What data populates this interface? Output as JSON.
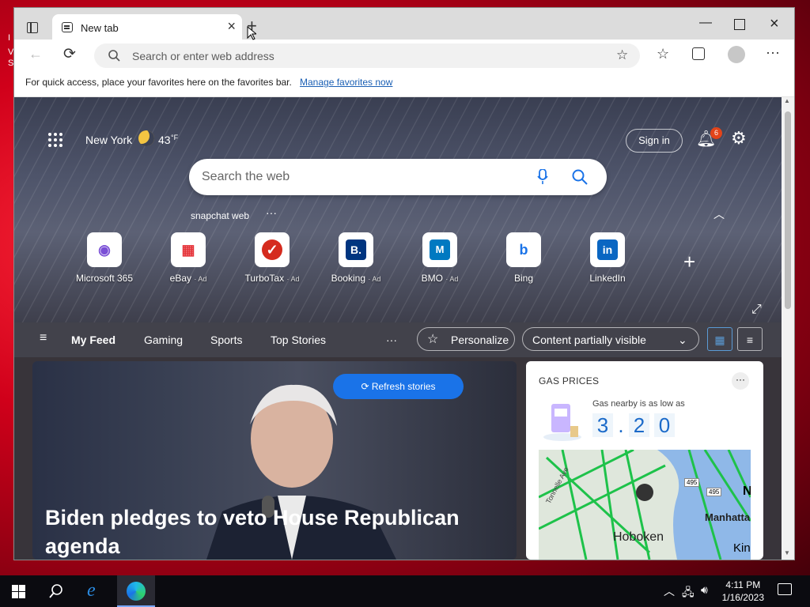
{
  "desktop": {
    "left_letters": [
      "I",
      "V",
      "S"
    ]
  },
  "browser": {
    "tab_title": "New tab",
    "address_placeholder": "Search or enter web address",
    "favorites_bar_text": "For quick access, place your favorites here on the favorites bar.",
    "favorites_bar_link": "Manage favorites now"
  },
  "newtab": {
    "location": "New York",
    "temperature": "43",
    "temp_unit": "°F",
    "search_placeholder": "Search the web",
    "suggestion": "snapchat web",
    "sign_in": "Sign in",
    "notification_count": "6",
    "quick_links": [
      {
        "label": "Microsoft 365",
        "ad": ""
      },
      {
        "label": "eBay",
        "ad": "· Ad"
      },
      {
        "label": "TurboTax",
        "ad": "· Ad"
      },
      {
        "label": "Booking",
        "ad": "· Ad"
      },
      {
        "label": "BMO",
        "ad": "· Ad"
      },
      {
        "label": "Bing",
        "ad": ""
      },
      {
        "label": "LinkedIn",
        "ad": ""
      }
    ],
    "feed_tabs": [
      "My Feed",
      "Gaming",
      "Sports",
      "Top Stories"
    ],
    "more": "···",
    "personalize": "Personalize",
    "content_visibility": "Content partially visible",
    "refresh": "Refresh stories",
    "headline": "Biden pledges to veto House Republican agenda",
    "gas": {
      "title": "GAS PRICES",
      "subtitle": "Gas nearby is as low as",
      "digits": [
        "3",
        "2",
        "0"
      ],
      "separator": ".",
      "map_labels": [
        "Hoboken",
        "Manhatta",
        "495",
        "495",
        "Tonnelle Ave",
        "N",
        "Kin"
      ]
    }
  },
  "taskbar": {
    "time": "4:11 PM",
    "date": "1/16/2023"
  },
  "colors": {
    "accent": "#1a73e8",
    "desktop": "#d0001a",
    "price": "#1b6ac9"
  }
}
